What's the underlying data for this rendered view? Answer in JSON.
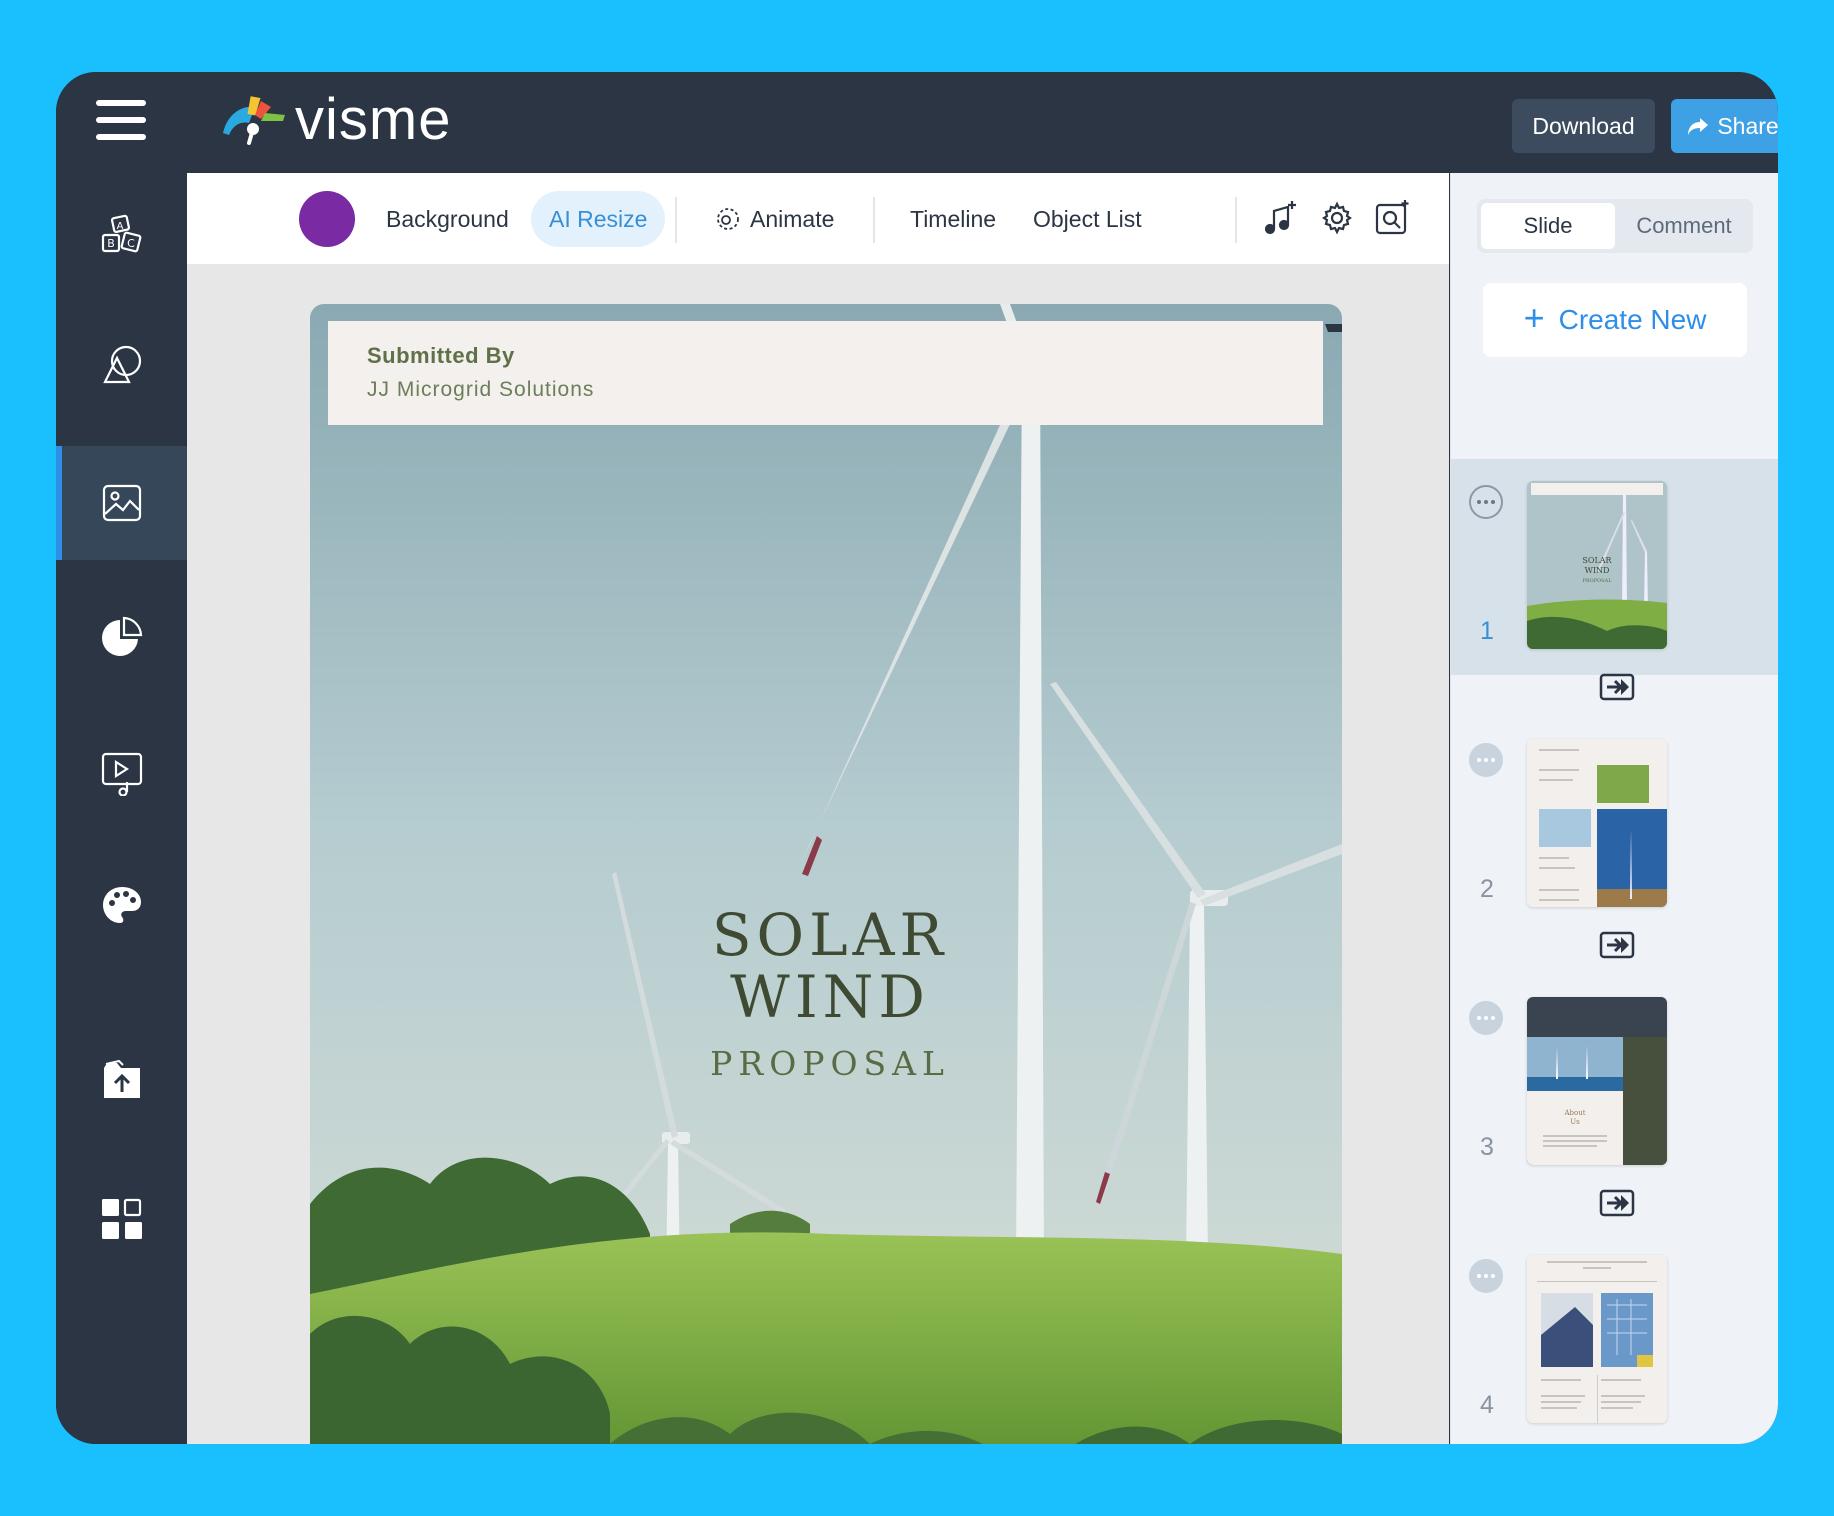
{
  "app": {
    "logo_text": "visme"
  },
  "topbar": {
    "download_label": "Download",
    "share_label": "Share"
  },
  "toolbar": {
    "background_label": "Background",
    "ai_resize_label": "AI Resize",
    "animate_label": "Animate",
    "timeline_label": "Timeline",
    "object_list_label": "Object List",
    "color_swatch": "#7a2aa3"
  },
  "sidebar": {
    "items": [
      {
        "icon": "text-blocks-icon"
      },
      {
        "icon": "shapes-icon"
      },
      {
        "icon": "image-icon",
        "active": true
      },
      {
        "icon": "chart-icon"
      },
      {
        "icon": "media-icon"
      },
      {
        "icon": "palette-icon"
      },
      {
        "icon": "upload-icon"
      },
      {
        "icon": "apps-icon"
      }
    ]
  },
  "slide": {
    "submitted_by_label": "Submitted By",
    "company": "JJ Microgrid Solutions",
    "title_line1": "SOLAR",
    "title_line2": "WIND",
    "subtitle": "PROPOSAL"
  },
  "rpanel": {
    "tab_slide": "Slide",
    "tab_comment": "Comment",
    "create_new_label": "Create New",
    "slides": [
      {
        "number": "1",
        "active": true
      },
      {
        "number": "2",
        "active": false
      },
      {
        "number": "3",
        "active": false
      },
      {
        "number": "4",
        "active": false
      }
    ]
  },
  "colors": {
    "accent": "#2e8ee8",
    "page_bg": "#1ac0fd",
    "dark": "#2b3544"
  }
}
